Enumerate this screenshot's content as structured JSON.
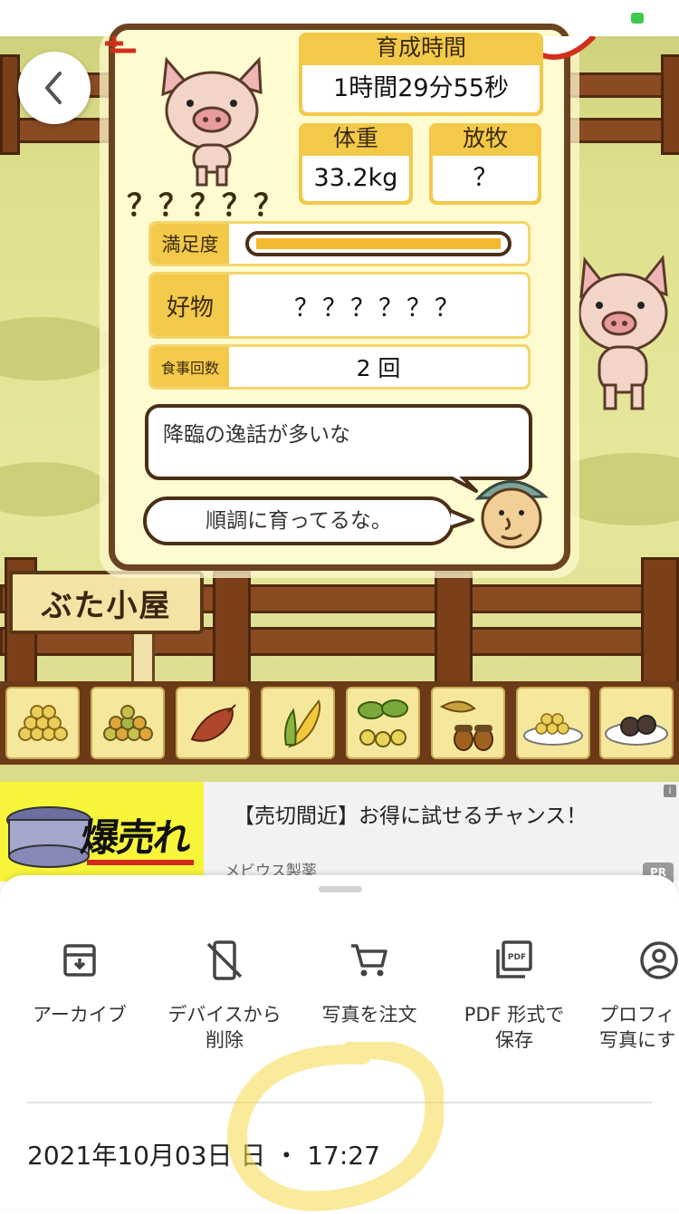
{
  "game": {
    "pig_name": "？？？？？",
    "growth_time": {
      "label": "育成時間",
      "value": "1時間29分55秒"
    },
    "weight": {
      "label": "体重",
      "value": "33.2kg"
    },
    "grazing": {
      "label": "放牧",
      "value": "？"
    },
    "satisfaction": {
      "label": "満足度",
      "level": 1.0
    },
    "favorite": {
      "label": "好物",
      "value": "？？？？？？"
    },
    "meal_count": {
      "label": "食事回数",
      "value": "2 回"
    },
    "comment_1": "降臨の逸話が多いな",
    "comment_2": "順調に育ってるな。",
    "hut_sign": "ぶた小屋",
    "foods": [
      "beans-yellow-icon",
      "beans-mixed-icon",
      "sweet-potato-icon",
      "corn-icon",
      "soybean-plant-icon",
      "acorn-icon",
      "grains-plate-icon",
      "meatball-plate-icon"
    ]
  },
  "ad": {
    "image_text": "爆売れ",
    "headline": "【売切間近】お得に試せるチャンス！",
    "advertiser": "メビウス製薬",
    "info_icon": "i",
    "badge": "PR"
  },
  "sheet": {
    "actions": [
      {
        "icon": "archive-icon",
        "label": "アーカイブ"
      },
      {
        "icon": "device-remove-icon",
        "label": "デバイスから\n削除"
      },
      {
        "icon": "cart-icon",
        "label": "写真を注文"
      },
      {
        "icon": "pdf-icon",
        "label": "PDF 形式で\n保存"
      },
      {
        "icon": "profile-icon",
        "label": "プロフィ\n写真にす"
      }
    ],
    "datetime": "2021年10月03日 日 ・ 17:27"
  },
  "colors": {
    "gold": "#f3c94a",
    "board": "#fffbd0",
    "wood": "#6b4320",
    "highlight": "#f5d84a"
  }
}
